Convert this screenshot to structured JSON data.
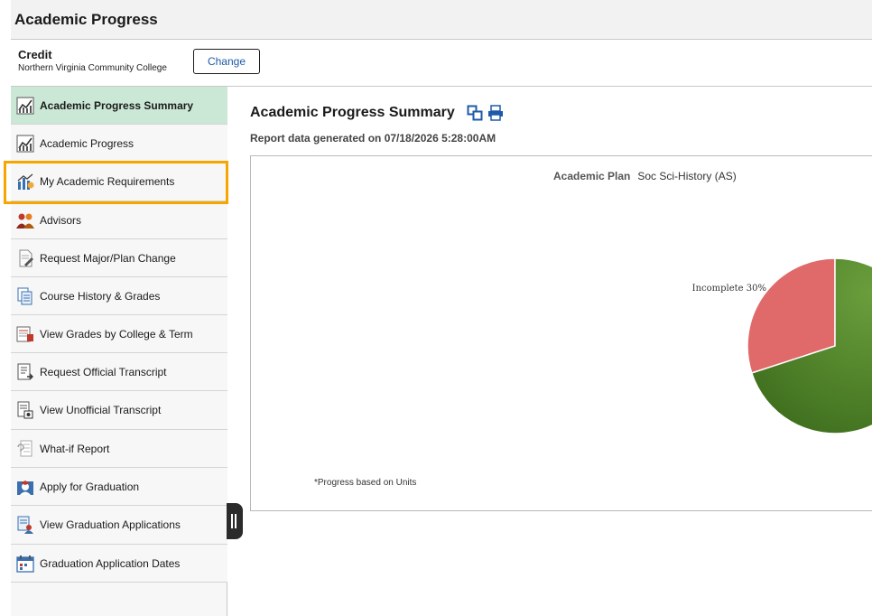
{
  "header": {
    "title": "Academic Progress"
  },
  "context": {
    "career": "Credit",
    "institution": "Northern Virginia Community College",
    "change_label": "Change"
  },
  "sidebar": {
    "items": [
      {
        "label": "Academic Progress Summary",
        "icon": "chart-icon",
        "active": true
      },
      {
        "label": "Academic Progress",
        "icon": "chart-icon",
        "active": false
      },
      {
        "label": "My Academic Requirements",
        "icon": "requirements-chart-icon",
        "active": false
      },
      {
        "label": "Advisors",
        "icon": "people-icon",
        "active": false
      },
      {
        "label": "Request Major/Plan Change",
        "icon": "edit-document-icon",
        "active": false
      },
      {
        "label": "Course History & Grades",
        "icon": "document-stack-icon",
        "active": false
      },
      {
        "label": "View Grades by College & Term",
        "icon": "grades-report-icon",
        "active": false
      },
      {
        "label": "Request Official Transcript",
        "icon": "transcript-request-icon",
        "active": false
      },
      {
        "label": "View Unofficial Transcript",
        "icon": "transcript-view-icon",
        "active": false
      },
      {
        "label": "What-if Report",
        "icon": "what-if-report-icon",
        "active": false
      },
      {
        "label": "Apply for Graduation",
        "icon": "graduation-apply-icon",
        "active": false
      },
      {
        "label": "View Graduation Applications",
        "icon": "graduation-applications-icon",
        "active": false
      },
      {
        "label": "Graduation Application Dates",
        "icon": "calendar-icon",
        "active": false
      }
    ]
  },
  "main": {
    "title": "Academic Progress Summary",
    "title_icons": [
      "new-window-icon",
      "print-icon"
    ],
    "report_date": "Report data generated on 07/18/2026 5:28:00AM",
    "plan_label": "Academic Plan",
    "plan_value": "Soc Sci-History (AS)",
    "note": "*Progress based on Units"
  },
  "chart_data": {
    "type": "pie",
    "slices": [
      {
        "label": "Incomplete 30%",
        "value": 30,
        "color": "#e06a6a"
      },
      {
        "value": 70,
        "color": "#5e8f36"
      }
    ]
  },
  "colors": {
    "accent": "#1e5aa8",
    "active_nav": "#cbe8d6",
    "highlight": "#f7a600"
  }
}
